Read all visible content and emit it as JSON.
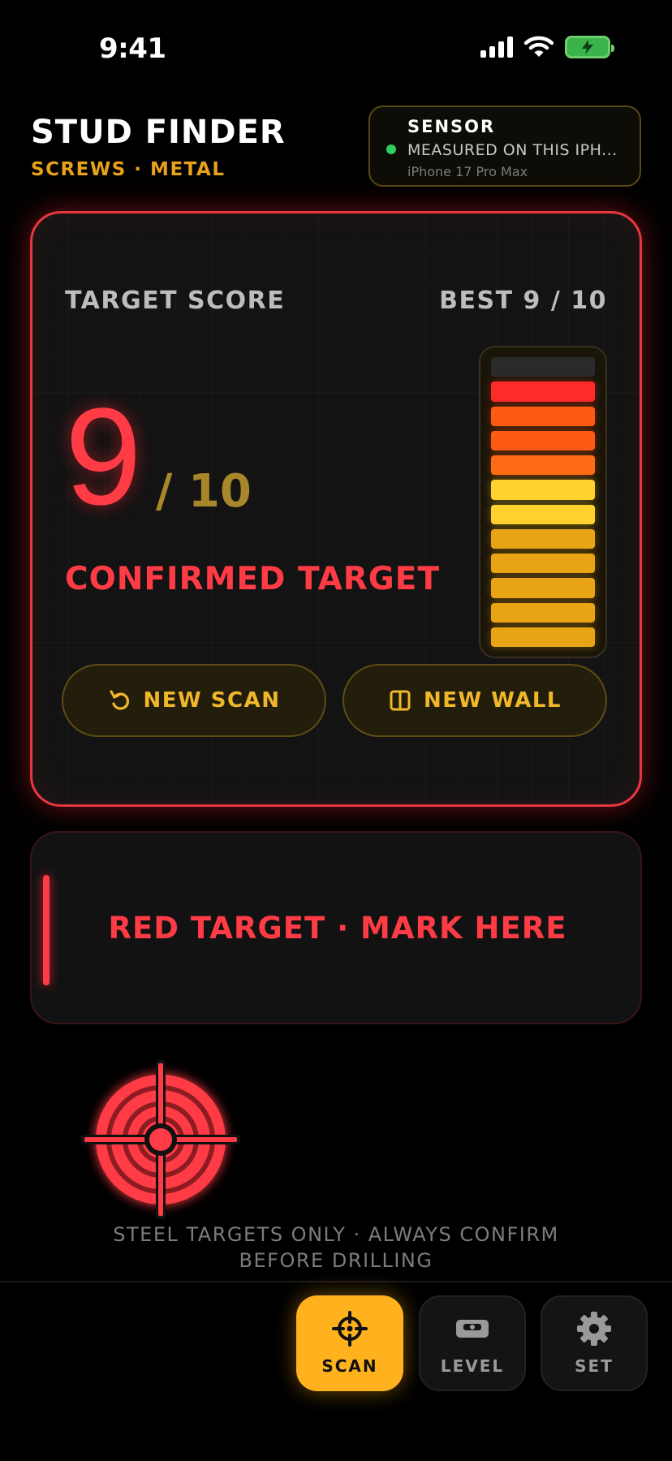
{
  "status_bar": {
    "time": "9:41"
  },
  "header": {
    "title": "STUD FINDER",
    "subtitle": "SCREWS · METAL"
  },
  "sensor": {
    "label": "SENSOR",
    "status": "MEASURED ON THIS IPH...",
    "device": "iPhone 17 Pro Max"
  },
  "score_card": {
    "label": "TARGET SCORE",
    "best": "BEST 9 / 10",
    "score": "9",
    "score_denominator": "/ 10",
    "status": "CONFIRMED TARGET",
    "meter_level": 0.9,
    "meter_segments": 11,
    "meter_colors": [
      "#2a2a2a",
      "#ff2a2a",
      "#ff5a14",
      "#ff5a14",
      "#ff6a14",
      "#ffd22e",
      "#ffd22e",
      "#e8a414",
      "#e8a414",
      "#e8a414",
      "#e8a414",
      "#e8a414"
    ]
  },
  "buttons": {
    "new_scan": "NEW SCAN",
    "new_wall": "NEW WALL"
  },
  "alert": {
    "text": "RED TARGET · MARK HERE"
  },
  "disclaimer": {
    "line1": "STEEL TARGETS ONLY · ALWAYS CONFIRM",
    "line2": "BEFORE DRILLING"
  },
  "tabs": {
    "scan": "SCAN",
    "level": "LEVEL",
    "set": "SET"
  },
  "colors": {
    "accent_red": "#ff3b45",
    "accent_amber": "#ffb21e",
    "sensor_ok": "#2ed060"
  }
}
